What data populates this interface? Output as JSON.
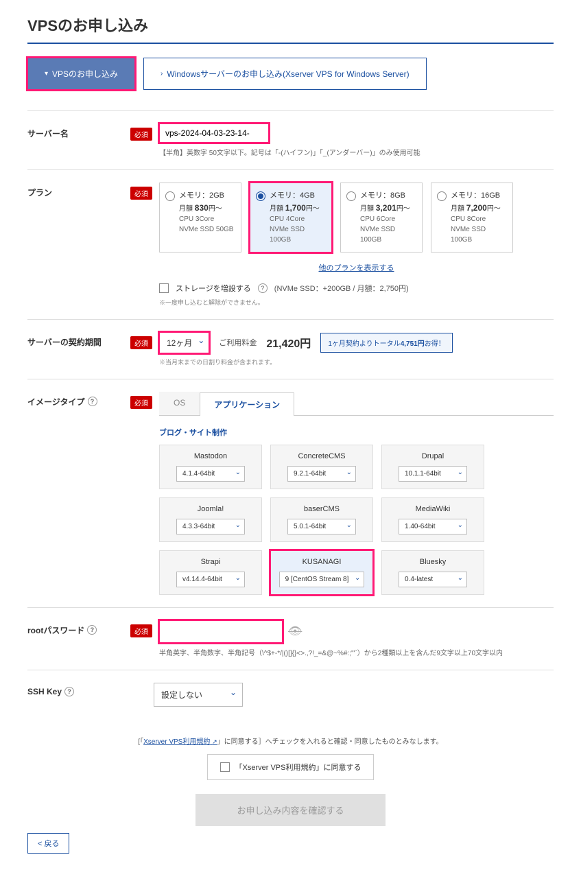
{
  "page_title": "VPSのお申し込み",
  "top_tabs": {
    "vps": "VPSのお申し込み",
    "windows": "Windowsサーバーのお申し込み(Xserver VPS for Windows Server)"
  },
  "required_label": "必須",
  "sections": {
    "server_name": {
      "label": "サーバー名",
      "value": "vps-2024-04-03-23-14-",
      "hint": "【半角】英数字 50文字以下。記号は「-(ハイフン)」「_(アンダーバー)」のみ使用可能"
    },
    "plan": {
      "label": "プラン",
      "options": [
        {
          "mem": "メモリ：2GB",
          "price_pre": "月額 ",
          "price": "830",
          "price_suf": "円～",
          "cpu": "CPU 3Core",
          "ssd": "NVMe SSD 50GB",
          "selected": false
        },
        {
          "mem": "メモリ：4GB",
          "price_pre": "月額 ",
          "price": "1,700",
          "price_suf": "円～",
          "cpu": "CPU 4Core",
          "ssd": "NVMe SSD 100GB",
          "selected": true
        },
        {
          "mem": "メモリ：8GB",
          "price_pre": "月額 ",
          "price": "3,201",
          "price_suf": "円～",
          "cpu": "CPU 6Core",
          "ssd": "NVMe SSD 100GB",
          "selected": false
        },
        {
          "mem": "メモリ：16GB",
          "price_pre": "月額 ",
          "price": "7,200",
          "price_suf": "円～",
          "cpu": "CPU 8Core",
          "ssd": "NVMe SSD 100GB",
          "selected": false
        }
      ],
      "show_more": "他のプランを表示する",
      "storage_add": "ストレージを増設する",
      "storage_note": "(NVMe SSD：+200GB / 月額：2,750円)",
      "storage_warn": "※一度申し込むと解除ができません。"
    },
    "period": {
      "label": "サーバーの契約期間",
      "value": "12ヶ月",
      "fee_label": "ご利用料金",
      "fee_value": "21,420円",
      "savings_pre": "1ヶ月契約よりトータル",
      "savings_amt": "4,751円",
      "savings_suf": "お得！",
      "note": "※当月末までの日割り料金が含まれます。"
    },
    "image": {
      "label": "イメージタイプ",
      "tabs": {
        "os": "OS",
        "app": "アプリケーション"
      },
      "category": "ブログ・サイト制作",
      "apps": [
        {
          "name": "Mastodon",
          "ver": "4.1.4-64bit"
        },
        {
          "name": "ConcreteCMS",
          "ver": "9.2.1-64bit"
        },
        {
          "name": "Drupal",
          "ver": "10.1.1-64bit"
        },
        {
          "name": "Joomla!",
          "ver": "4.3.3-64bit"
        },
        {
          "name": "baserCMS",
          "ver": "5.0.1-64bit"
        },
        {
          "name": "MediaWiki",
          "ver": "1.40-64bit"
        },
        {
          "name": "Strapi",
          "ver": "v4.14.4-64bit"
        },
        {
          "name": "KUSANAGI",
          "ver": "9 [CentOS Stream 8]",
          "selected": true
        },
        {
          "name": "Bluesky",
          "ver": "0.4-latest"
        }
      ]
    },
    "root_pw": {
      "label": "rootパスワード",
      "hint": "半角英字、半角数字、半角記号（\\^$+-*/|()[]{}<>.,?!_=&@~%#:;'\"`）から2種類以上を含んだ9文字以上70文字以内"
    },
    "ssh": {
      "label": "SSH Key",
      "value": "設定しない"
    }
  },
  "footer": {
    "terms_pre": "[「",
    "terms_link": "Xserver VPS利用規約",
    "terms_post": "」に同意する］へチェックを入れると確認・同意したものとみなします。",
    "terms_check": "「Xserver VPS利用規約」に同意する",
    "submit": "お申し込み内容を確認する",
    "back": "< 戻る"
  }
}
